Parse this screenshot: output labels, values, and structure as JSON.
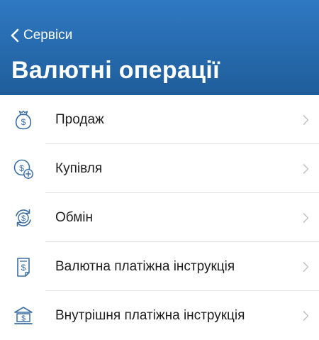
{
  "header": {
    "back_label": "Сервіси",
    "title": "Валютні операції",
    "gradient_top": "#2f79c3",
    "gradient_bottom": "#1f5d9a"
  },
  "icon_color": "#3a6ea3",
  "chevron_color": "#c7c7cc",
  "menu": {
    "items": [
      {
        "label": "Продаж",
        "icon": "money-bag-dollar-icon"
      },
      {
        "label": "Купівля",
        "icon": "dollar-coin-plus-icon"
      },
      {
        "label": "Обмін",
        "icon": "currency-exchange-icon"
      },
      {
        "label": "Валютна платіжна інструкція",
        "icon": "dollar-document-icon"
      },
      {
        "label": "Внутрішня платіжна інструкція",
        "icon": "bank-dollar-icon"
      }
    ]
  }
}
